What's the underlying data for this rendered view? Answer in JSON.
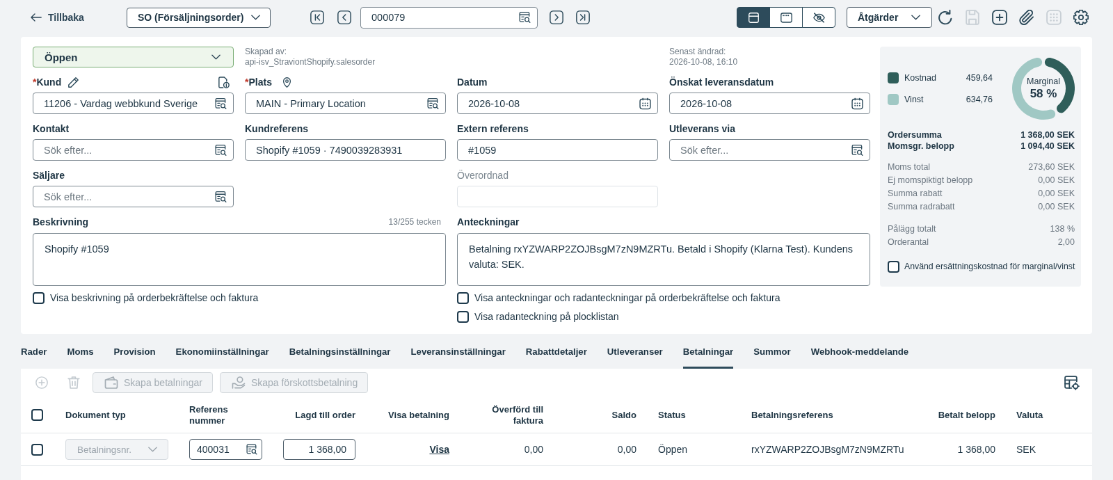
{
  "top_bar": {
    "back_link": "Tillbaka",
    "doc_type": "SO (Försäljningsorder)",
    "order_number": "000079",
    "view_modes": [
      {
        "kind": "layout",
        "selected": true
      },
      {
        "kind": "header",
        "selected": false
      },
      {
        "kind": "hidden",
        "selected": false
      }
    ],
    "actions_button": "Åtgärder",
    "tools": [
      {
        "kind": "refresh",
        "disabled": false
      },
      {
        "kind": "save",
        "disabled": true
      },
      {
        "kind": "add",
        "disabled": false
      },
      {
        "kind": "attach",
        "disabled": false
      },
      {
        "kind": "calendar",
        "disabled": true
      },
      {
        "kind": "settings",
        "disabled": false
      }
    ]
  },
  "order": {
    "status": "Öppen",
    "created": {
      "label": "Skapad av:",
      "value": "api-isv_StraviontShopify.salesorder"
    },
    "modified": {
      "label": "Senast ändrad:",
      "value": "2026-10-08, 16:10"
    },
    "field_rows": [
      [
        {
          "label": "Kund",
          "required_mark": "*",
          "kind": "search",
          "value": "11206 - Vardag webbkund Sverige",
          "disabled": false
        },
        {
          "label": "Plats",
          "required_mark": "*",
          "kind": "search",
          "value": "MAIN - Primary Location",
          "disabled": false
        },
        {
          "label": "Datum",
          "kind": "date",
          "value": "2026-10-08",
          "disabled": false
        },
        {
          "label": "Önskat leveransdatum",
          "kind": "date",
          "value": "2026-10-08",
          "disabled": false
        }
      ],
      [
        {
          "label": "Kontakt",
          "kind": "search",
          "placeholder": "Sök efter...",
          "disabled": false
        },
        {
          "label": "Kundreferens",
          "kind": "text",
          "value": "Shopify #1059 · 7490039283931",
          "disabled": false
        },
        {
          "label": "Extern referens",
          "kind": "text",
          "value": "#1059",
          "disabled": false
        },
        {
          "label": "Utleverans via",
          "kind": "search",
          "placeholder": "Sök efter...",
          "disabled": false
        }
      ],
      [
        {
          "label": "Säljare",
          "kind": "search",
          "placeholder": "Sök efter...",
          "disabled": false
        },
        {
          "label": "Överordnad",
          "kind": "text",
          "disabled": true
        }
      ],
      [
        {
          "label": "Beskrivning",
          "kind": "textarea",
          "counter": "13/255 tecken",
          "value": "Shopify #1059",
          "disabled": false,
          "options": [
            {
              "label": "Visa beskrivning på orderbekräftelse och faktura",
              "checked": false
            }
          ]
        },
        {
          "label": "Anteckningar",
          "kind": "textarea",
          "value": "Betalning rxYZWARP2ZOJBsgM7zN9MZRTu. Betald i Shopify (Klarna Test). Kundens valuta: SEK.",
          "disabled": false,
          "options": [
            {
              "label": "Visa anteckningar och radanteckningar på orderbekräftelse och faktura",
              "checked": false
            },
            {
              "label": "Visa radanteckning på plocklistan",
              "checked": false
            }
          ]
        }
      ]
    ]
  },
  "summary": {
    "chart_data": {
      "type": "donut",
      "categories": [
        "Kostnad",
        "Vinst"
      ],
      "values": [
        42,
        58
      ]
    },
    "legend": [
      {
        "value": "459,64",
        "color": "#2f5e5a"
      },
      {
        "value": "634,76",
        "color": "#a0c8c4"
      }
    ],
    "center_label": "Marginal",
    "center_value": "58 %",
    "groups": [
      {
        "kind": "totals",
        "rows": [
          {
            "label": "Ordersumma",
            "value": "1 368,00 SEK"
          },
          {
            "label": "Momsgr. belopp",
            "value": "1 094,40 SEK"
          }
        ]
      },
      {
        "kind": "details",
        "rows": [
          {
            "label": "Moms total",
            "value": "273,60 SEK"
          },
          {
            "label": "Ej momspiktigt belopp",
            "value": "0,00 SEK"
          },
          {
            "label": "Summa rabatt",
            "value": "0,00 SEK"
          },
          {
            "label": "Summa radrabatt",
            "value": "0,00 SEK"
          }
        ]
      },
      {
        "kind": "details",
        "rows": [
          {
            "label": "Pålägg totalt",
            "value": "138 %"
          },
          {
            "label": "Orderantal",
            "value": "2,00"
          }
        ]
      }
    ],
    "option": {
      "label": "Använd ersättningskostnad för marginal/vinst",
      "checked": false
    }
  },
  "tabs": [
    {
      "label": "Rader",
      "selected": false
    },
    {
      "label": "Moms",
      "selected": false
    },
    {
      "label": "Provision",
      "selected": false
    },
    {
      "label": "Ekonomiinställningar",
      "selected": false
    },
    {
      "label": "Betalningsinställningar",
      "selected": false
    },
    {
      "label": "Leveransinställningar",
      "selected": false
    },
    {
      "label": "Rabattdetaljer",
      "selected": false
    },
    {
      "label": "Utleveranser",
      "selected": false
    },
    {
      "label": "Betalningar",
      "selected": true
    },
    {
      "label": "Summor",
      "selected": false
    },
    {
      "label": "Webhook-meddelande",
      "selected": false
    }
  ],
  "payments": {
    "tools": [
      {
        "kind": "add",
        "disabled": true
      },
      {
        "kind": "delete",
        "disabled": true
      },
      {
        "kind": "create",
        "label": "Skapa betalningar",
        "disabled": true
      },
      {
        "kind": "prepay",
        "label": "Skapa förskottsbetalning",
        "disabled": true
      }
    ],
    "select_all": {
      "checked": false
    },
    "columns": [
      "Dokument typ",
      "Referens nummer",
      "Lagd till order",
      "Visa betalning",
      "Överförd till faktura",
      "Saldo",
      "Status",
      "Betalningsreferens",
      "Betalt belopp",
      "Valuta"
    ],
    "rows": [
      {
        "checked": false,
        "cells": [
          {
            "kind": "select",
            "value": "Betalningsnr.",
            "disabled": true
          },
          {
            "kind": "search",
            "value": "400031",
            "disabled": false
          },
          {
            "kind": "amount",
            "value": "1 368,00",
            "disabled": false
          },
          {
            "kind": "link",
            "text": "Visa"
          },
          {
            "kind": "text",
            "text": "0,00"
          },
          {
            "kind": "text",
            "text": "0,00"
          },
          {
            "kind": "text",
            "text": "Öppen"
          },
          {
            "kind": "text",
            "text": "rxYZWARP2ZOJBsgM7zN9MZRTu"
          },
          {
            "kind": "text",
            "text": "1 368,00"
          },
          {
            "kind": "text",
            "text": "SEK"
          }
        ]
      }
    ]
  }
}
